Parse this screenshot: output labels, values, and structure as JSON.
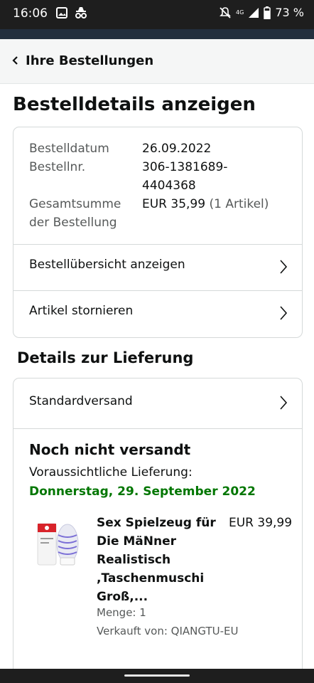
{
  "status_bar": {
    "time": "16:06",
    "battery": "73 %",
    "network": "4G"
  },
  "nav": {
    "back_label": "Ihre Bestellungen"
  },
  "page_title": "Bestelldetails anzeigen",
  "order": {
    "date_label": "Bestelldatum",
    "date_value": "26.09.2022",
    "number_label": "Bestellnr.",
    "number_line1": "306-1381689-",
    "number_line2": "4404368",
    "total_label_line1": "Gesamtsumme",
    "total_label_line2": "der Bestellung",
    "total_value": "EUR 35,99",
    "total_items": "(1 Artikel)",
    "link_overview": "Bestellübersicht anzeigen",
    "link_cancel": "Artikel stornieren"
  },
  "delivery": {
    "section_title": "Details zur Lieferung",
    "method": "Standardversand",
    "status": "Noch nicht versandt",
    "expected_label": "Voraussichtliche Lieferung:",
    "expected_date": "Donnerstag, 29. September 2022"
  },
  "product": {
    "title_lines": [
      "Sex Spielzeug für",
      "Die MäNner",
      "Realistisch",
      ",Taschenmuschi",
      "Groß,..."
    ],
    "price": "EUR 39,99",
    "quantity": "Menge: 1",
    "seller": "Verkauft von: QIANGTU-EU",
    "image_icon": "product-thumbnail"
  },
  "colors": {
    "delivery_green": "#007600",
    "appbar": "#232f3e",
    "statusbar": "#1e1e1e"
  }
}
